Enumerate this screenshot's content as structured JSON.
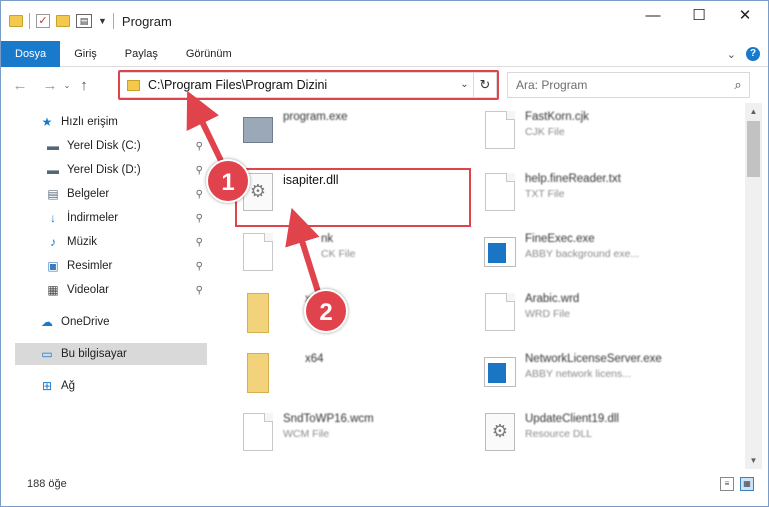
{
  "window": {
    "title": "Program",
    "min_glyph": "—",
    "max_glyph": "☐",
    "close_glyph": "✕"
  },
  "ribbon": {
    "tabs": [
      {
        "label": "Dosya",
        "active": true
      },
      {
        "label": "Giriş"
      },
      {
        "label": "Paylaş"
      },
      {
        "label": "Görünüm"
      }
    ],
    "expand_glyph": "⌄",
    "help_glyph": "?"
  },
  "nav": {
    "back_glyph": "←",
    "forward_glyph": "→",
    "recent_glyph": "⌄",
    "up_glyph": "↑",
    "address": "C:\\Program Files\\Program Dizini",
    "address_dropdown_glyph": "⌄",
    "refresh_glyph": "↻",
    "search_placeholder": "Ara: Program",
    "search_glyph": "⌕"
  },
  "sidebar": {
    "items": [
      {
        "label": "Hızlı erişim",
        "icon": "star-icon",
        "glyph": "★",
        "color": "#1979ca",
        "pinned": false
      },
      {
        "label": "Yerel Disk (C:)",
        "icon": "drive-icon",
        "glyph": "▬",
        "color": "#556677",
        "pinned": true
      },
      {
        "label": "Yerel Disk (D:)",
        "icon": "drive-icon",
        "glyph": "▬",
        "color": "#556677",
        "pinned": true
      },
      {
        "label": "Belgeler",
        "icon": "documents-icon",
        "glyph": "▤",
        "color": "#5b6c7d",
        "pinned": true
      },
      {
        "label": "İndirmeler",
        "icon": "download-icon",
        "glyph": "↓",
        "color": "#1979ca",
        "pinned": true
      },
      {
        "label": "Müzik",
        "icon": "music-icon",
        "glyph": "♪",
        "color": "#1979ca",
        "pinned": true
      },
      {
        "label": "Resimler",
        "icon": "pictures-icon",
        "glyph": "▣",
        "color": "#3a7bbf",
        "pinned": true
      },
      {
        "label": "Videolar",
        "icon": "video-icon",
        "glyph": "▦",
        "color": "#4a4a4a",
        "pinned": true
      },
      {
        "label": "OneDrive",
        "icon": "onedrive-icon",
        "glyph": "☁",
        "color": "#1979ca",
        "pinned": false
      },
      {
        "label": "Bu bilgisayar",
        "icon": "computer-icon",
        "glyph": "▭",
        "color": "#1979ca",
        "pinned": false,
        "selected": true
      },
      {
        "label": "Ağ",
        "icon": "network-icon",
        "glyph": "⊞",
        "color": "#1979ca",
        "pinned": false
      }
    ],
    "pin_glyph": "📌"
  },
  "files": [
    {
      "name": "program.exe",
      "type": "",
      "icon": "program-icon"
    },
    {
      "name": "FastKorn.cjk",
      "type": "CJK File",
      "icon": "doc-icon"
    },
    {
      "name": "isapiter.dll",
      "type": "",
      "icon": "gear-doc-icon",
      "sharp": true
    },
    {
      "name": "help.fineReader.txt",
      "type": "TXT File",
      "icon": "doc-icon"
    },
    {
      "name": "nk",
      "type": "CK File",
      "icon": "doc-icon"
    },
    {
      "name": "FineExec.exe",
      "type": "ABBY background exe...",
      "icon": "exe-icon"
    },
    {
      "name": "x64",
      "type": "",
      "icon": "folder-icon"
    },
    {
      "name": "Arabic.wrd",
      "type": "WRD File",
      "icon": "doc-icon"
    },
    {
      "name": "x64",
      "type": "",
      "icon": "folder-icon"
    },
    {
      "name": "NetworkLicenseServer.exe",
      "type": "ABBY network licens...",
      "icon": "exe-icon"
    },
    {
      "name": "SndToWP16.wcm",
      "type": "WCM File",
      "icon": "doc-icon"
    },
    {
      "name": "UpdateClient19.dll",
      "type": "Resource DLL",
      "icon": "gear-doc-icon"
    }
  ],
  "annotations": {
    "step1": "1",
    "step2": "2"
  },
  "status": {
    "count": "188 öğe"
  },
  "scroll": {
    "up_glyph": "▲",
    "down_glyph": "▼"
  }
}
